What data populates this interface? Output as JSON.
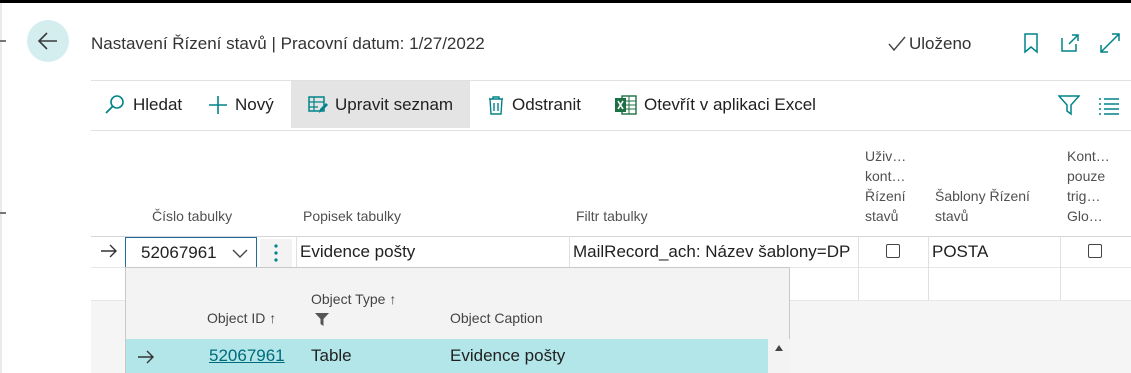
{
  "header": {
    "title": "Nastavení Řízení stavů | Pracovní datum: 1/27/2022",
    "saved_label": "Uloženo"
  },
  "actions": {
    "search": "Hledat",
    "new": "Nový",
    "edit_list": "Upravit seznam",
    "delete": "Odstranit",
    "open_excel": "Otevřít v aplikaci Excel"
  },
  "columns": {
    "table_no": "Číslo tabulky",
    "table_caption": "Popisek tabulky",
    "table_filter": "Filtr tabulky",
    "user_control": [
      "Uživ…",
      "kont…",
      "Řízení",
      "stavů"
    ],
    "templates": [
      "Šablony Řízení",
      "stavů"
    ],
    "trigger_only": [
      "Kont…",
      "pouze",
      "trig…",
      "Glo…"
    ]
  },
  "rows": [
    {
      "table_no": "52067961",
      "table_caption": "Evidence pošty",
      "table_filter": "MailRecord_ach: Název šablony=DP",
      "user_control": false,
      "templates": "POSTA",
      "trigger_only": false
    }
  ],
  "lookup": {
    "headers": {
      "object_id": "Object ID",
      "object_type": "Object Type",
      "object_caption": "Object Caption",
      "sort_arrow": "↑"
    },
    "rows": [
      {
        "object_id": "52067961",
        "object_type": "Table",
        "object_caption": "Evidence pošty"
      }
    ]
  },
  "colors": {
    "accent": "#008489",
    "selected_row": "#b3e6e9",
    "back_button": "#d4eef0"
  }
}
